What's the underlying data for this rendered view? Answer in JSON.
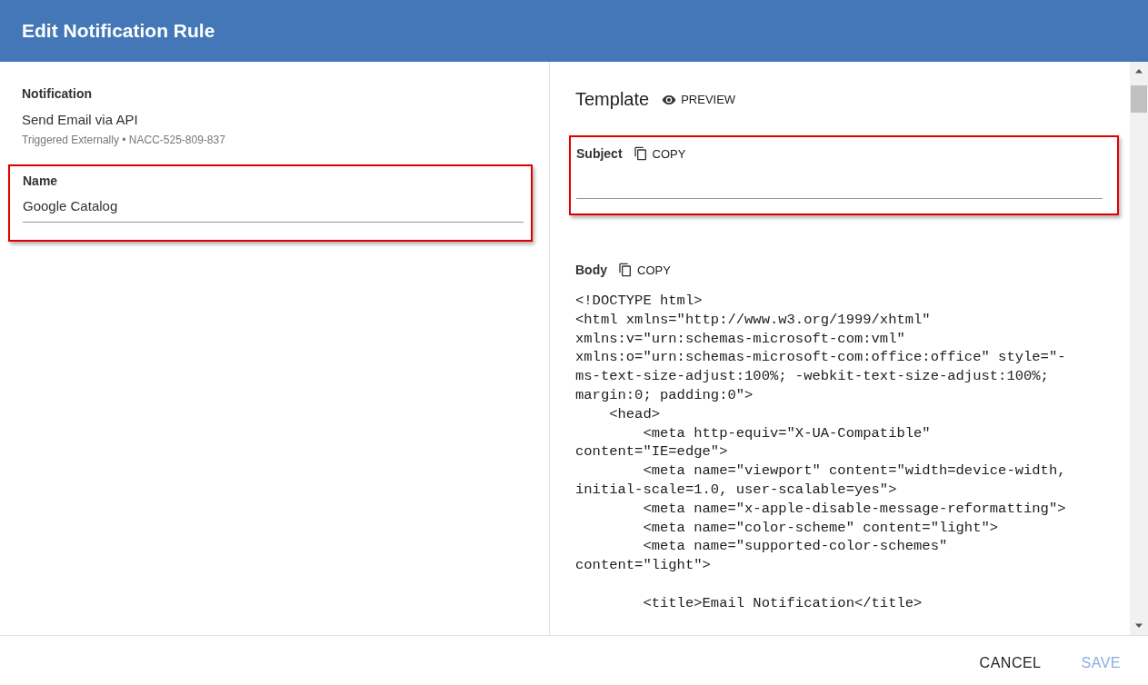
{
  "header": {
    "title": "Edit Notification Rule"
  },
  "notification": {
    "label": "Notification",
    "name": "Send Email via API",
    "subtitle": "Triggered Externally • NACC-525-809-837"
  },
  "name_field": {
    "label": "Name",
    "value": "Google Catalog",
    "highlighted": true
  },
  "template": {
    "title": "Template",
    "preview": "PREVIEW",
    "subject": {
      "label": "Subject",
      "copy": "COPY",
      "highlighted": true
    },
    "body": {
      "label": "Body",
      "copy": "COPY",
      "code_blocks": [
        [
          "<!DOCTYPE html>",
          "<html xmlns=\"http://www.w3.org/1999/xhtml\"",
          "xmlns:v=\"urn:schemas-microsoft-com:vml\"",
          "xmlns:o=\"urn:schemas-microsoft-com:office:office\" style=\"-",
          "ms-text-size-adjust:100%; -webkit-text-size-adjust:100%;",
          "margin:0; padding:0\">",
          "    <head>",
          "        <meta http-equiv=\"X-UA-Compatible\"",
          "content=\"IE=edge\">",
          "        <meta name=\"viewport\" content=\"width=device-width,",
          "initial-scale=1.0, user-scalable=yes\">",
          "        <meta name=\"x-apple-disable-message-reformatting\">",
          "        <meta name=\"color-scheme\" content=\"light\">",
          "        <meta name=\"supported-color-schemes\"",
          "content=\"light\">"
        ],
        [
          "        <title>Email Notification</title>"
        ]
      ]
    }
  },
  "footer": {
    "buttons": [
      {
        "label": "CANCEL",
        "disabled": false
      },
      {
        "label": "SAVE",
        "disabled": true
      }
    ]
  }
}
